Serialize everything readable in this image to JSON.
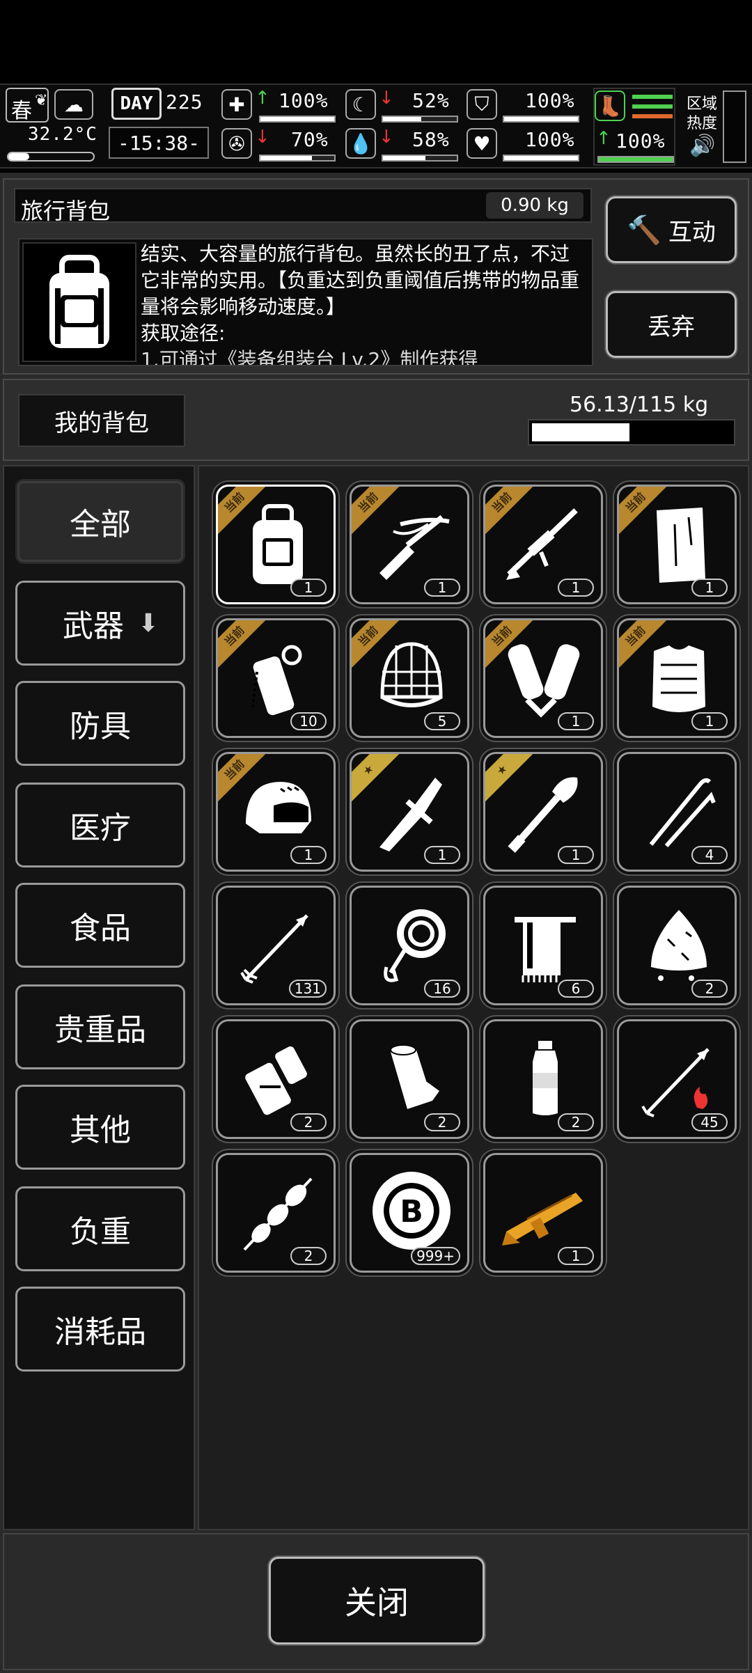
{
  "status": {
    "season": "春",
    "temperature": "32.2°C",
    "day_label": "DAY",
    "day_number": "225",
    "time": "-15:38-",
    "health_pct": "100%",
    "stomach_pct": "52%",
    "armor_pct": "100%",
    "stamina_pct": "100%",
    "weight_pct": "70%",
    "water_pct": "58%",
    "heart_pct": "100%",
    "zone_heat_label": "区域热度",
    "bars": {
      "health": 100,
      "stomach": 52,
      "armor": 100,
      "stamina": 100,
      "weight": 70,
      "water": 58,
      "heart": 100
    }
  },
  "item_info": {
    "name": "旅行背包",
    "weight": "0.90 kg",
    "description": "结实、大容量的旅行背包。虽然长的丑了点，不过它非常的实用。【负重达到负重阈值后携带的物品重量将会影响移动速度。】",
    "source_label": "获取途径:",
    "source_partial": "1.可通过《装备组装台 Lv.2》制作获得"
  },
  "actions": {
    "interact": "互动",
    "discard": "丢弃",
    "close": "关闭"
  },
  "bag": {
    "label": "我的背包",
    "capacity": "56.13/115 kg",
    "load_fraction": 0.49
  },
  "categories": [
    "全部",
    "武器",
    "防具",
    "医疗",
    "食品",
    "贵重品",
    "其他",
    "负重",
    "消耗品"
  ],
  "tags": {
    "equipped": "当前",
    "star": "★"
  },
  "items": [
    {
      "name": "travel-backpack",
      "count": "1",
      "tag": "equipped"
    },
    {
      "name": "crossbow",
      "count": "1",
      "tag": "equipped"
    },
    {
      "name": "sniper-rifle",
      "count": "1",
      "tag": "equipped"
    },
    {
      "name": "wood-plank",
      "count": "1",
      "tag": "equipped"
    },
    {
      "name": "grenade",
      "count": "10",
      "tag": "equipped"
    },
    {
      "name": "net-hood",
      "count": "5",
      "tag": "equipped"
    },
    {
      "name": "shin-guards",
      "count": "1",
      "tag": "equipped"
    },
    {
      "name": "body-armor",
      "count": "1",
      "tag": "equipped"
    },
    {
      "name": "helmet",
      "count": "1",
      "tag": "equipped"
    },
    {
      "name": "combat-knife",
      "count": "1",
      "tag": "star"
    },
    {
      "name": "shovel",
      "count": "1",
      "tag": "star"
    },
    {
      "name": "lockpicks",
      "count": "4",
      "tag": ""
    },
    {
      "name": "arrow",
      "count": "131",
      "tag": ""
    },
    {
      "name": "rope",
      "count": "16",
      "tag": ""
    },
    {
      "name": "towel",
      "count": "6",
      "tag": ""
    },
    {
      "name": "rag",
      "count": "2",
      "tag": ""
    },
    {
      "name": "water-filter",
      "count": "2",
      "tag": ""
    },
    {
      "name": "bandage-roll",
      "count": "2",
      "tag": ""
    },
    {
      "name": "water-bottle",
      "count": "2",
      "tag": ""
    },
    {
      "name": "fire-arrow",
      "count": "45",
      "tag": ""
    },
    {
      "name": "meat-skewer",
      "count": "2",
      "tag": ""
    },
    {
      "name": "bitcoin-token",
      "count": "999+",
      "tag": ""
    },
    {
      "name": "golden-shotgun",
      "count": "1",
      "tag": ""
    }
  ],
  "colors": {
    "accent_green": "#4fd14f",
    "arrow_red": "#e33333",
    "tag_gold": "#b8872e",
    "gun_gold": "#e9a326"
  }
}
